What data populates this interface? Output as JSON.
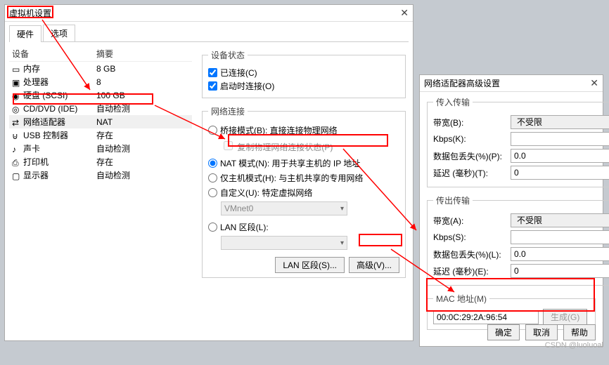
{
  "win1": {
    "title": "虚拟机设置",
    "tabs": {
      "hardware": "硬件",
      "options": "选项"
    },
    "headers": {
      "device": "设备",
      "summary": "摘要"
    },
    "devices": [
      {
        "name": "内存",
        "summary": "8 GB",
        "icon": "memory"
      },
      {
        "name": "处理器",
        "summary": "8",
        "icon": "cpu"
      },
      {
        "name": "硬盘 (SCSI)",
        "summary": "100 GB",
        "icon": "disk"
      },
      {
        "name": "CD/DVD (IDE)",
        "summary": "自动检测",
        "icon": "cd"
      },
      {
        "name": "网络适配器",
        "summary": "NAT",
        "icon": "net",
        "selected": true
      },
      {
        "name": "USB 控制器",
        "summary": "存在",
        "icon": "usb"
      },
      {
        "name": "声卡",
        "summary": "自动检测",
        "icon": "sound"
      },
      {
        "name": "打印机",
        "summary": "存在",
        "icon": "printer"
      },
      {
        "name": "显示器",
        "summary": "自动检测",
        "icon": "display"
      }
    ],
    "status": {
      "legend": "设备状态",
      "connected": "已连接(C)",
      "connect_on": "启动时连接(O)"
    },
    "netconn": {
      "legend": "网络连接",
      "bridged": "桥接模式(B): 直接连接物理网络",
      "replicate": "复制物理网络连接状态(P)",
      "nat": "NAT 模式(N): 用于共享主机的 IP 地址",
      "hostonly": "仅主机模式(H): 与主机共享的专用网络",
      "custom": "自定义(U): 特定虚拟网络",
      "vmnet": "VMnet0",
      "lan": "LAN 区段(L):"
    },
    "buttons": {
      "lan": "LAN 区段(S)...",
      "adv": "高级(V)..."
    }
  },
  "win2": {
    "title": "网络适配器高级设置",
    "incoming": {
      "legend": "传入传输",
      "bandwidth": "带宽(B):",
      "bandwidth_val": "不受限",
      "kbps": "Kbps(K):",
      "kbps_val": "",
      "loss": "数据包丢失(%)(P):",
      "loss_val": "0.0",
      "latency": "延迟 (毫秒)(T):",
      "latency_val": "0"
    },
    "outgoing": {
      "legend": "传出传输",
      "bandwidth": "带宽(A):",
      "bandwidth_val": "不受限",
      "kbps": "Kbps(S):",
      "kbps_val": "",
      "loss": "数据包丢失(%)(L):",
      "loss_val": "0.0",
      "latency": "延迟 (毫秒)(E):",
      "latency_val": "0"
    },
    "mac": {
      "legend": "MAC 地址(M)",
      "value": "00:0C:29:2A:96:54",
      "gen": "生成(G)"
    },
    "footer": {
      "ok": "确定",
      "cancel": "取消",
      "help": "帮助"
    }
  },
  "watermark": "CSDN @luoluoal"
}
